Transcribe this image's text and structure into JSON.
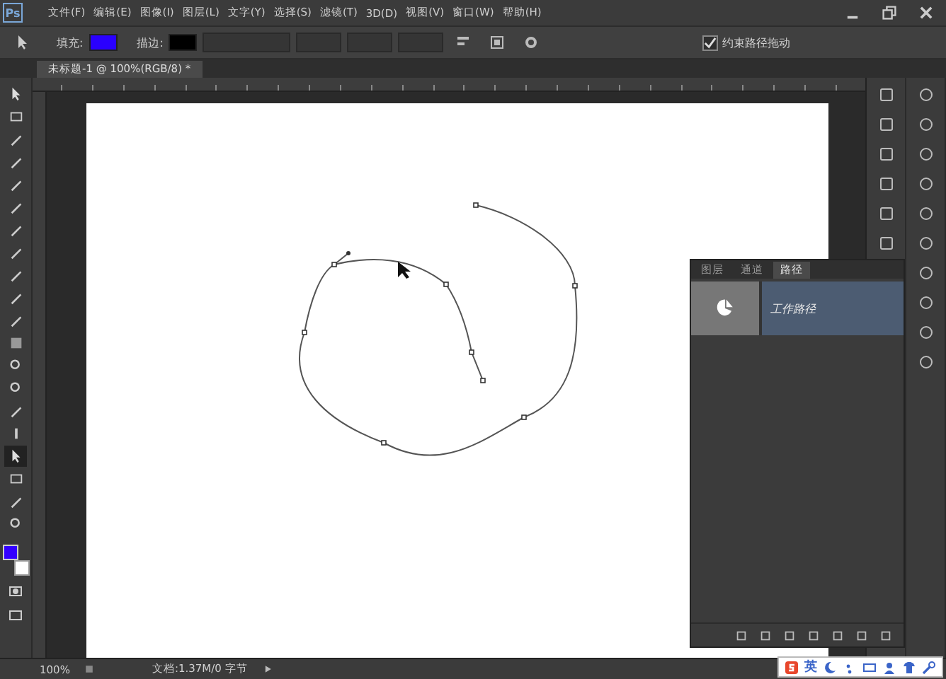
{
  "app": {
    "logo": "Ps"
  },
  "menu": [
    "文件(F)",
    "编辑(E)",
    "图像(I)",
    "图层(L)",
    "文字(Y)",
    "选择(S)",
    "滤镜(T)",
    "3D(D)",
    "视图(V)",
    "窗口(W)",
    "帮助(H)"
  ],
  "options_bar": {
    "fill": {
      "label": "填充:",
      "color": "#2a00ff"
    },
    "stroke": {
      "label": "描边:",
      "color": "#000000"
    },
    "constrain": {
      "label": "约束路径拖动",
      "checked": true
    }
  },
  "document_tab": {
    "title": "未标题-1 @ 100%(RGB/8) *"
  },
  "toolbox": {
    "tools": [
      {
        "selected": false
      },
      {
        "selected": false
      },
      {
        "selected": false
      },
      {
        "selected": false
      },
      {
        "selected": false
      },
      {
        "selected": false
      },
      {
        "selected": false
      },
      {
        "selected": false
      },
      {
        "selected": false
      },
      {
        "selected": false
      },
      {
        "selected": false
      },
      {
        "selected": false
      },
      {
        "selected": false
      },
      {
        "selected": false
      },
      {
        "selected": false
      },
      {
        "selected": false
      },
      {
        "selected": true
      },
      {
        "selected": false
      },
      {
        "selected": false
      },
      {
        "selected": false
      }
    ],
    "color_swatches": [
      {
        "kind": "foreground",
        "color": "#3300ff"
      },
      {
        "kind": "background",
        "color": "#ffffff"
      }
    ]
  },
  "paths_panel": {
    "tabs": [
      {
        "label": "图层",
        "selected": false
      },
      {
        "label": "通道",
        "selected": false
      },
      {
        "label": "路径",
        "selected": true
      }
    ],
    "items": [
      {
        "name": "工作路径",
        "selected": true
      }
    ]
  },
  "status_bar": {
    "zoom": "100%",
    "doc_info": "文档:1.37M/0 字节"
  },
  "ime_bar": {
    "mode": "英"
  }
}
